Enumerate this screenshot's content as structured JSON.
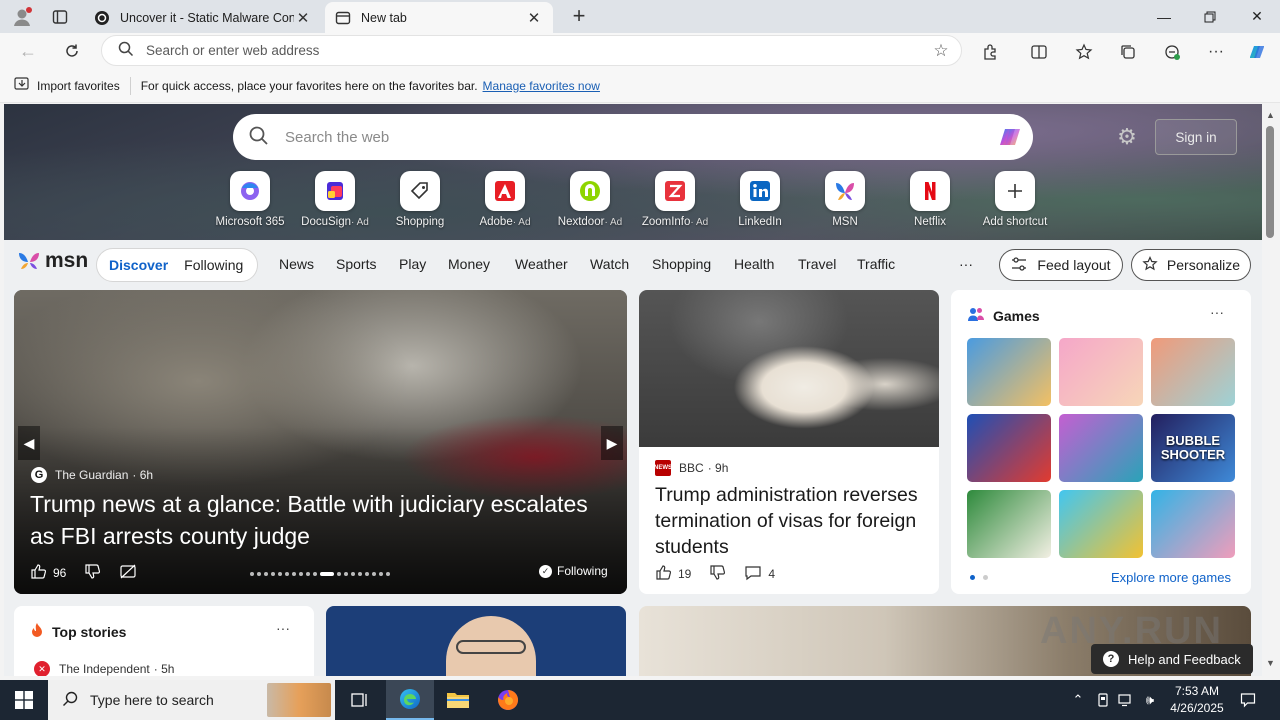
{
  "browser": {
    "tabs": [
      {
        "title": "Uncover it - Static Malware Confi",
        "active": false
      },
      {
        "title": "New tab",
        "active": true
      }
    ],
    "address_placeholder": "Search or enter web address",
    "favorites_bar": {
      "import_label": "Import favorites",
      "hint": "For quick access, place your favorites here on the favorites bar.",
      "manage_link": "Manage favorites now"
    }
  },
  "newtab": {
    "search_placeholder": "Search the web",
    "signin_label": "Sign in",
    "shortcuts": [
      {
        "label": "Microsoft 365",
        "ad": false
      },
      {
        "label": "DocuSign",
        "ad": true
      },
      {
        "label": "Shopping",
        "ad": false
      },
      {
        "label": "Adobe",
        "ad": true
      },
      {
        "label": "Nextdoor",
        "ad": true
      },
      {
        "label": "ZoomInfo",
        "ad": true
      },
      {
        "label": "LinkedIn",
        "ad": false
      },
      {
        "label": "MSN",
        "ad": false
      },
      {
        "label": "Netflix",
        "ad": false
      },
      {
        "label": "Add shortcut",
        "ad": false
      }
    ],
    "ad_marker": "· Ad"
  },
  "msn": {
    "logo": "msn",
    "pills": [
      "Discover",
      "Following"
    ],
    "nav": [
      "News",
      "Sports",
      "Play",
      "Money",
      "Weather",
      "Watch",
      "Shopping",
      "Health",
      "Travel",
      "Traffic"
    ],
    "more": "···",
    "feed_layout": "Feed layout",
    "personalize": "Personalize"
  },
  "hero_story": {
    "source": "The Guardian",
    "age": "· 6h",
    "headline": "Trump news at a glance: Battle with judiciary escalates as FBI arrests county judge",
    "likes": "96",
    "following": "Following"
  },
  "bbc_story": {
    "source": "BBC",
    "age": "· 9h",
    "headline": "Trump administration reverses termination of visas for foreign students",
    "likes": "19",
    "comments": "4"
  },
  "games": {
    "title": "Games",
    "more": "···",
    "explore": "Explore more games",
    "tiles": [
      {
        "colors": [
          "#4a9be0",
          "#f3c063"
        ],
        "text": ""
      },
      {
        "colors": [
          "#f5a7c9",
          "#f7d6b8"
        ],
        "text": ""
      },
      {
        "colors": [
          "#f09a7a",
          "#9dd2d6"
        ],
        "text": ""
      },
      {
        "colors": [
          "#1f4fb5",
          "#e23b2f"
        ],
        "text": ""
      },
      {
        "colors": [
          "#c45fd1",
          "#2aa3b8"
        ],
        "text": ""
      },
      {
        "colors": [
          "#231f5e",
          "#3f8ad8"
        ],
        "text": "BUBBLE SHOOTER"
      },
      {
        "colors": [
          "#2e8a3c",
          "#f2efe3"
        ],
        "text": ""
      },
      {
        "colors": [
          "#42c6f0",
          "#f2c232"
        ],
        "text": ""
      },
      {
        "colors": [
          "#33b3e6",
          "#f09dbb"
        ],
        "text": ""
      }
    ]
  },
  "top_stories": {
    "title": "Top stories",
    "more": "···",
    "source": "The Independent",
    "age": "· 5h"
  },
  "help_feedback": "Help and Feedback",
  "watermark": "ANY.RUN",
  "taskbar": {
    "search_placeholder": "Type here to search",
    "time": "7:53 AM",
    "date": "4/26/2025"
  }
}
